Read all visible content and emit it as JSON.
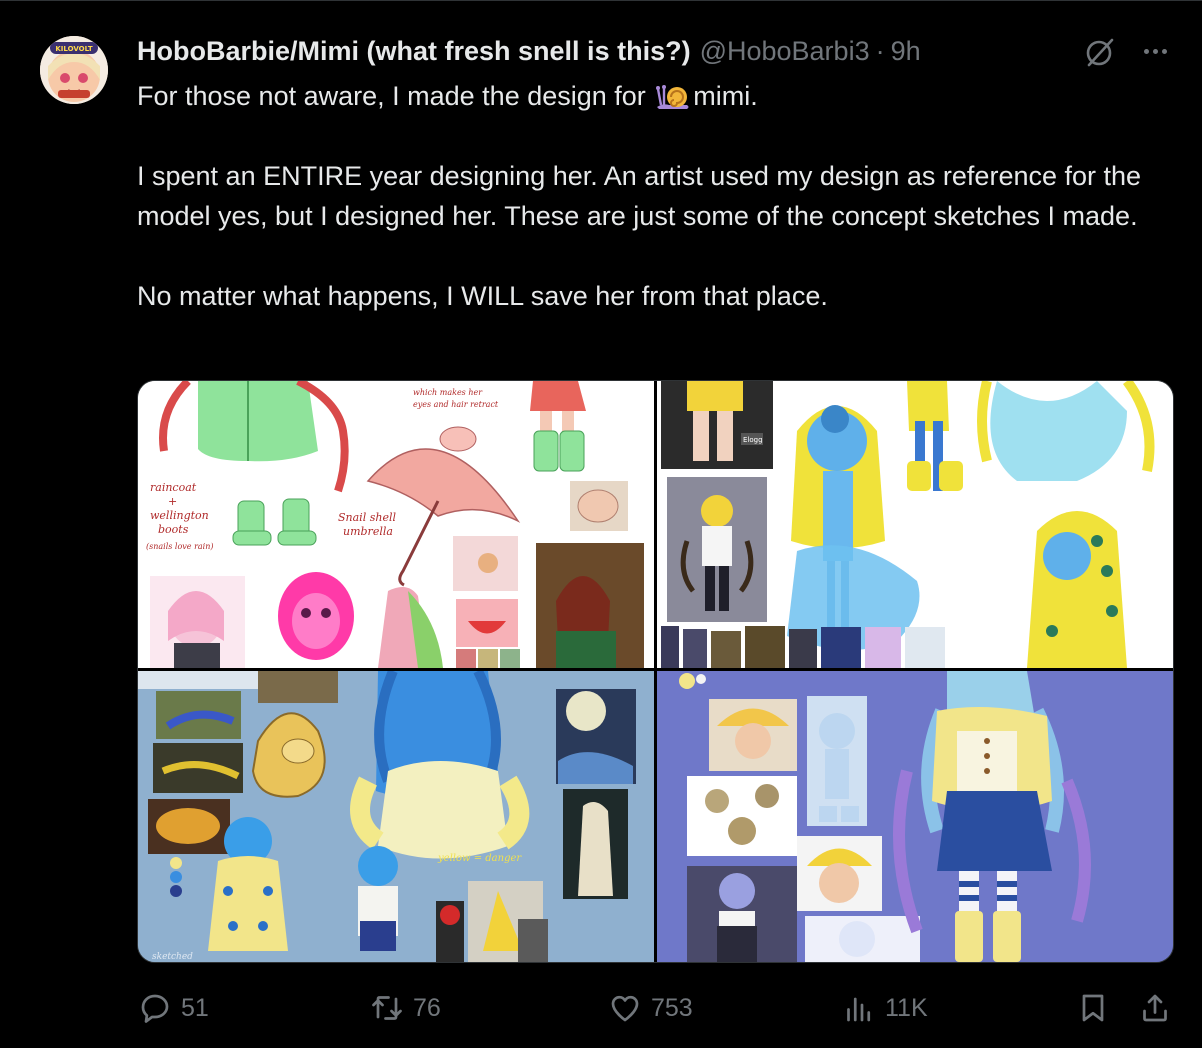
{
  "tweet": {
    "display_name": "HoboBarbie/Mimi (what fresh snell is this?)",
    "handle": "@HoboBarbi3",
    "separator": "·",
    "time": "9h",
    "avatar_badge": "KILOVOLT",
    "lines": [
      {
        "before": "For those not aware, I made the design for",
        "emoji": "snail-emoji",
        "after": "mimi."
      },
      {
        "text": "I spent an ENTIRE year designing her. An artist used my design as reference for the model yes, but I designed her. These are just some of the concept sketches I made."
      },
      {
        "text": "No matter what happens, I WILL save her from that place."
      }
    ]
  },
  "media": {
    "tiles": [
      {
        "name": "concept-sketch-image-1",
        "bg": "#ffffff",
        "annotations": [
          "raincoat",
          "+",
          "wellington",
          "boots",
          "(snails love rain)",
          "Snail shell",
          "umbrella",
          "which makes her",
          "eyes and hair retract"
        ]
      },
      {
        "name": "concept-sketch-image-2",
        "bg": "#ffffff",
        "annotations": [
          "Elogg"
        ]
      },
      {
        "name": "concept-sketch-image-3",
        "bg": "#8fb0cf",
        "annotations": [
          "yellow = danger",
          "sketched"
        ]
      },
      {
        "name": "concept-sketch-image-4",
        "bg": "#6f78c9",
        "annotations": []
      }
    ]
  },
  "actions": {
    "reply_count": "51",
    "retweet_count": "76",
    "like_count": "753",
    "views_count": "11K"
  },
  "colors": {
    "background": "#000000",
    "text": "#e7e9ea",
    "muted": "#71767b",
    "border": "#2f3336"
  },
  "icons": [
    "grok-icon",
    "more-icon",
    "reply-icon",
    "retweet-icon",
    "like-icon",
    "views-icon",
    "bookmark-icon",
    "share-icon"
  ]
}
